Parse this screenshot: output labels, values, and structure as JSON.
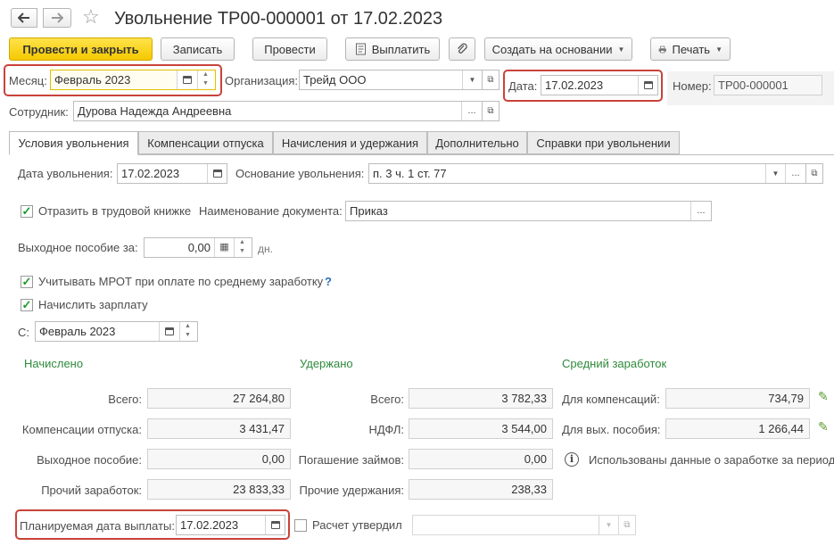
{
  "header": {
    "title": "Увольнение ТР00-000001 от 17.02.2023",
    "back_icon": "arrow-left-icon",
    "forward_icon": "arrow-right-icon",
    "favorite_icon": "star-icon"
  },
  "toolbar": {
    "post_close": "Провести и закрыть",
    "save": "Записать",
    "post": "Провести",
    "pay": "Выплатить",
    "create_based": "Создать на основании",
    "print": "Печать"
  },
  "form": {
    "month_label": "Месяц:",
    "month_value": "Февраль 2023",
    "org_label": "Организация:",
    "org_value": "Трейд ООО",
    "date_label": "Дата:",
    "date_value": "17.02.2023",
    "number_label": "Номер:",
    "number_value": "ТР00-000001",
    "employee_label": "Сотрудник:",
    "employee_value": "Дурова Надежда Андреевна"
  },
  "tabs": [
    {
      "label": "Условия увольнения"
    },
    {
      "label": "Компенсации отпуска"
    },
    {
      "label": "Начисления и удержания"
    },
    {
      "label": "Дополнительно"
    },
    {
      "label": "Справки при увольнении"
    }
  ],
  "conditions": {
    "dismissal_date_label": "Дата увольнения:",
    "dismissal_date_value": "17.02.2023",
    "basis_label": "Основание увольнения:",
    "basis_value": "п. 3 ч. 1 ст. 77",
    "workbook_label": "Отразить в трудовой книжке",
    "doc_name_label": "Наименование документа:",
    "doc_name_value": "Приказ",
    "severance_label": "Выходное пособие за:",
    "severance_value": "0,00",
    "severance_unit": "дн.",
    "mrot_label": "Учитывать МРОТ при оплате по среднему заработку",
    "mrot_help": "?",
    "salary_label": "Начислить зарплату",
    "from_label": "С:",
    "from_value": "Февраль 2023"
  },
  "accrued": {
    "header": "Начислено",
    "total_label": "Всего:",
    "total_value": "27 264,80",
    "vacation_label": "Компенсации отпуска:",
    "vacation_value": "3 431,47",
    "severance_label": "Выходное пособие:",
    "severance_value": "0,00",
    "other_label": "Прочий заработок:",
    "other_value": "23 833,33"
  },
  "withheld": {
    "header": "Удержано",
    "total_label": "Всего:",
    "total_value": "3 782,33",
    "ndfl_label": "НДФЛ:",
    "ndfl_value": "3 544,00",
    "loans_label": "Погашение займов:",
    "loans_value": "0,00",
    "other_label": "Прочие удержания:",
    "other_value": "238,33"
  },
  "average": {
    "header": "Средний заработок",
    "comp_label": "Для компенсаций:",
    "comp_value": "734,79",
    "sev_label": "Для вых. пособия:",
    "sev_value": "1 266,44",
    "info_text": "Использованы данные о заработке за период"
  },
  "footer": {
    "pay_date_label": "Планируемая дата выплаты:",
    "pay_date_value": "17.02.2023",
    "approved_label": "Расчет утвердил",
    "approved_value": ""
  },
  "colors": {
    "accent_yellow": "#f5c800",
    "highlight_red": "#c9423a",
    "section_green": "#2f8a3b",
    "check_green": "#1a9a2a"
  }
}
